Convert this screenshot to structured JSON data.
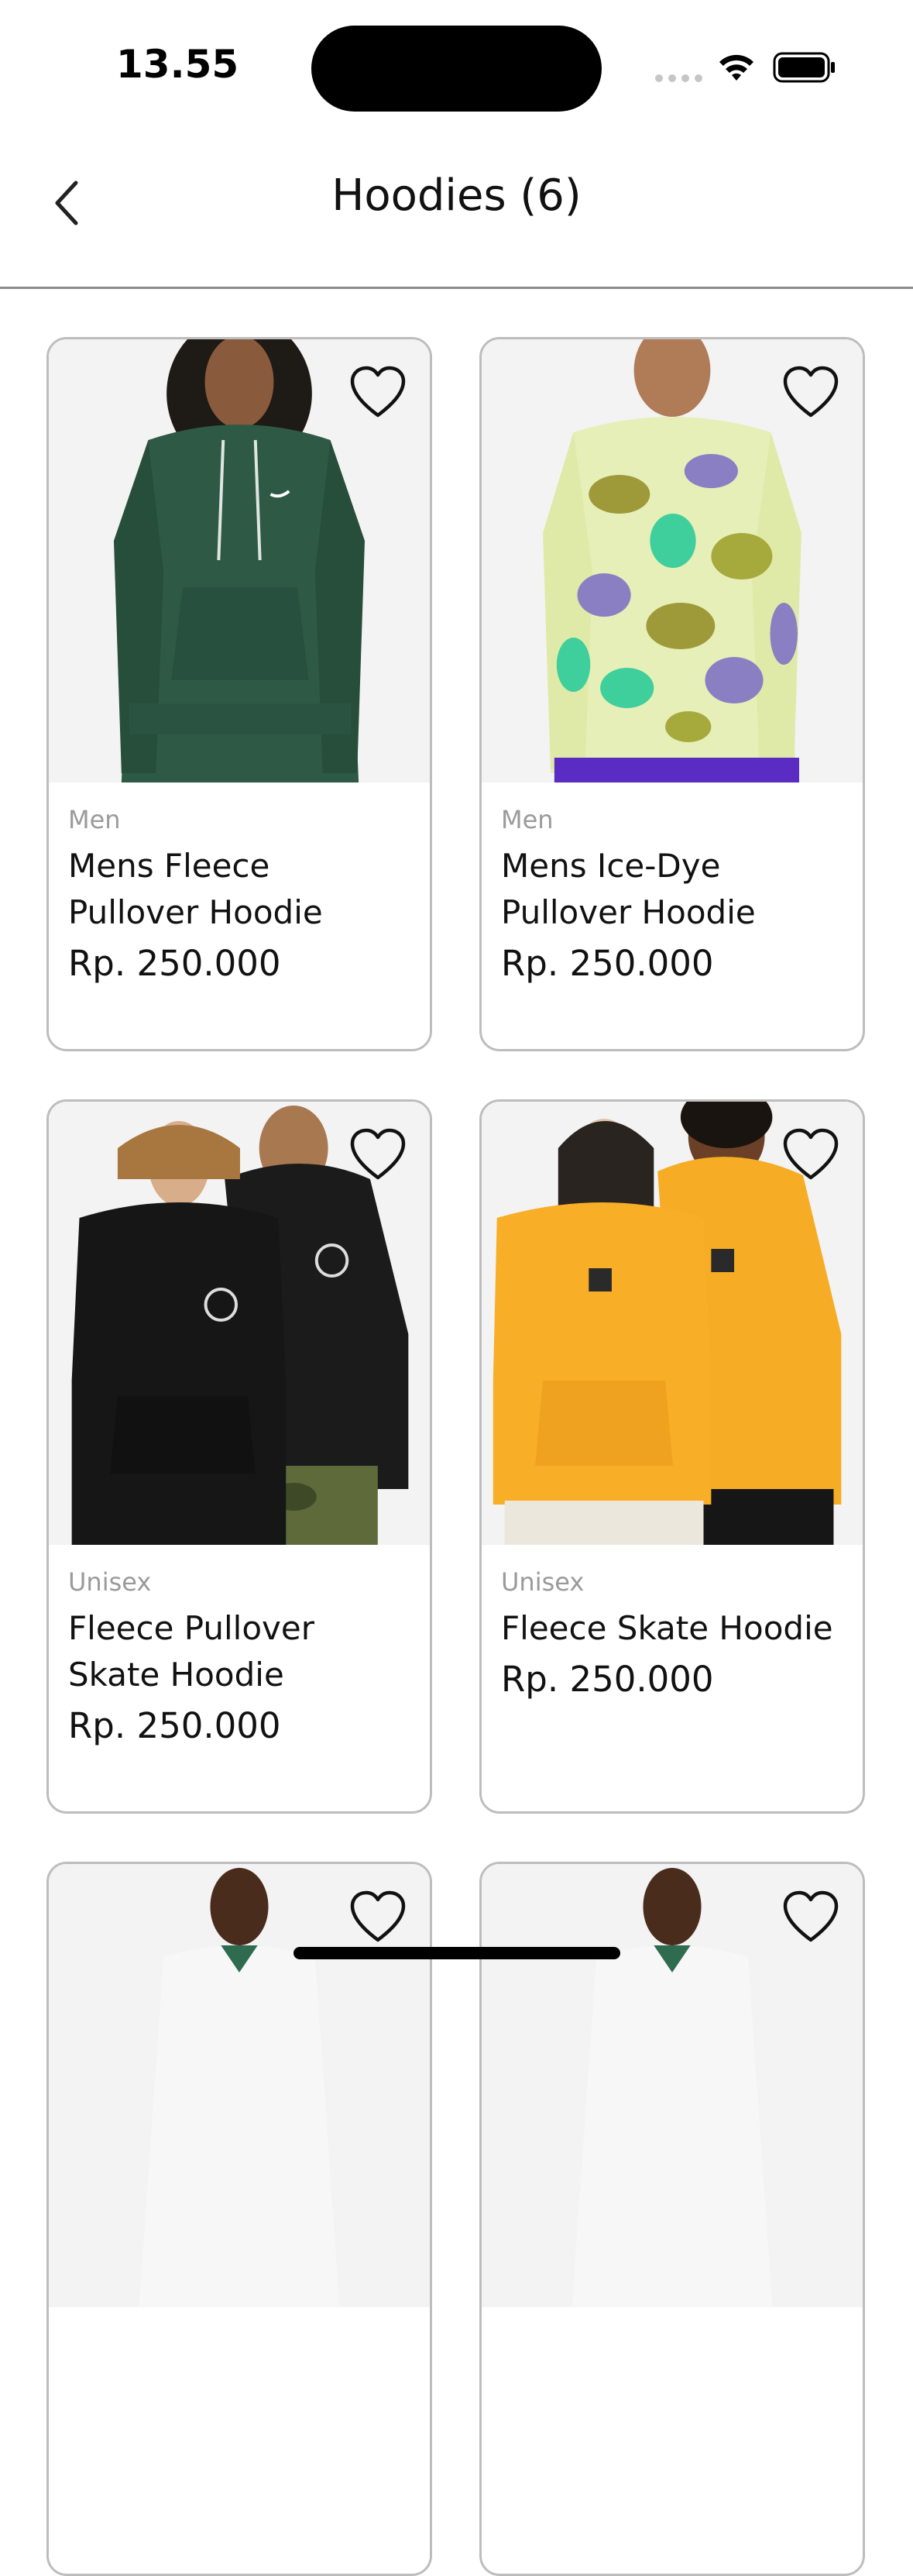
{
  "status_bar": {
    "time": "13.55"
  },
  "nav": {
    "title": "Hoodies (6)"
  },
  "products": [
    {
      "category": "Men",
      "name_line1": "Mens Fleece",
      "name_line2": "Pullover Hoodie",
      "price": "Rp. 250.000",
      "palette": "green"
    },
    {
      "category": "Men",
      "name_line1": "Mens Ice-Dye",
      "name_line2": "Pullover Hoodie",
      "price": "Rp. 250.000",
      "palette": "tiedye"
    },
    {
      "category": "Unisex",
      "name_line1": "Fleece Pullover",
      "name_line2": "Skate Hoodie",
      "price": "Rp. 250.000",
      "palette": "black"
    },
    {
      "category": "Unisex",
      "name_line1": "Fleece Skate Hoodie",
      "name_line2": "",
      "price": "Rp. 250.000",
      "palette": "yellow"
    },
    {
      "category": "",
      "name_line1": "",
      "name_line2": "",
      "price": "",
      "palette": "white"
    },
    {
      "category": "",
      "name_line1": "",
      "name_line2": "",
      "price": "",
      "palette": "white"
    }
  ],
  "colors": {
    "card_border": "#bdbdbd",
    "category_text": "#9a9a9a",
    "image_bg": "#f3f3f3",
    "green_hoodie": "#2e5a45",
    "black_hoodie": "#1a1a1a",
    "yellow_hoodie": "#f6ad25",
    "tiedye_base": "#e6efb7"
  },
  "icons": {
    "back": "chevron-left-icon",
    "favorite": "heart-outline-icon",
    "wifi": "wifi-icon",
    "battery": "battery-icon"
  }
}
